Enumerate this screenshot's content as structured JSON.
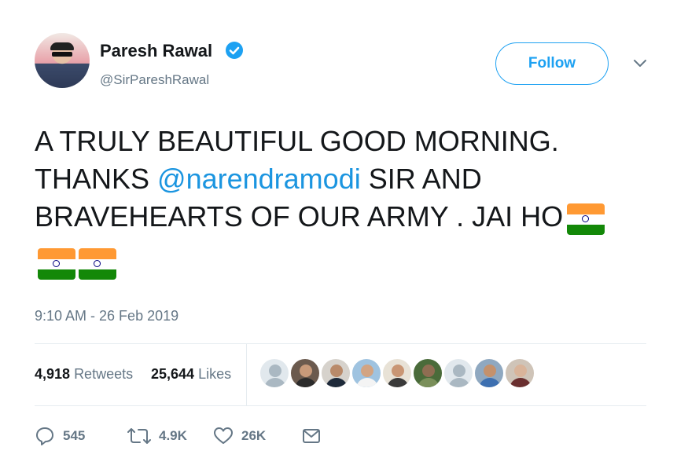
{
  "header": {
    "name": "Paresh Rawal",
    "handle": "@SirPareshRawal",
    "follow_label": "Follow"
  },
  "tweet": {
    "line1": "A TRULY BEAUTIFUL GOOD MORNING.",
    "line2_prefix": "THANKS ",
    "mention": "@narendramodi",
    "line2_suffix": " SIR AND",
    "line3": "BRAVEHEARTS OF OUR ARMY . JAI HO . ",
    "flag_count": 3
  },
  "timestamp": "9:10 AM - 26 Feb 2019",
  "stats": {
    "retweets_count": "4,918",
    "retweets_label": "Retweets",
    "likes_count": "25,644",
    "likes_label": "Likes"
  },
  "likers": [
    {
      "icon": "default-avatar",
      "skin": "#aab8c2",
      "bg": "#e1e8ed",
      "shirt": "#aab8c2"
    },
    {
      "icon": "user-avatar",
      "skin": "#c89a7a",
      "bg": "#6b5a4e",
      "shirt": "#2b2b2b"
    },
    {
      "icon": "user-avatar",
      "skin": "#b98a6a",
      "bg": "#d6d2cc",
      "shirt": "#1e2a3a"
    },
    {
      "icon": "user-avatar",
      "skin": "#d2a483",
      "bg": "#9fc3e0",
      "shirt": "#f4f4f4"
    },
    {
      "icon": "user-avatar",
      "skin": "#c99674",
      "bg": "#e8e2d6",
      "shirt": "#3a3a3a"
    },
    {
      "icon": "user-avatar",
      "skin": "#8f6d52",
      "bg": "#4a6b3a",
      "shirt": "#7a8f5a"
    },
    {
      "icon": "default-avatar",
      "skin": "#aab8c2",
      "bg": "#e1e8ed",
      "shirt": "#aab8c2"
    },
    {
      "icon": "user-avatar",
      "skin": "#c4916c",
      "bg": "#8fa8c0",
      "shirt": "#3d6fb0"
    },
    {
      "icon": "user-avatar",
      "skin": "#d9b49a",
      "bg": "#cfc4b8",
      "shirt": "#6a2f2f"
    }
  ],
  "actions": {
    "reply_icon": "reply-icon",
    "reply_count": "545",
    "retweet_icon": "retweet-icon",
    "retweet_count": "4.9K",
    "like_icon": "heart-icon",
    "like_count": "26K",
    "dm_icon": "envelope-icon"
  },
  "colors": {
    "accent": "#1da1f2",
    "mention": "#1b95e0",
    "secondary_text": "#657786",
    "divider": "#e6ecf0"
  }
}
